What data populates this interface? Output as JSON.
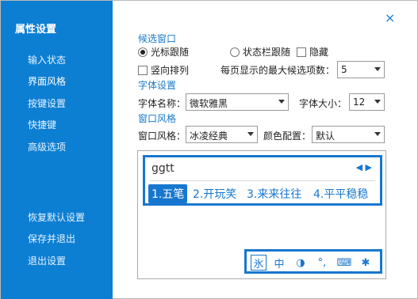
{
  "sidebar": {
    "title": "属性设置",
    "items": [
      {
        "label": "输入状态"
      },
      {
        "label": "界面风格"
      },
      {
        "label": "按键设置"
      },
      {
        "label": "快捷键"
      },
      {
        "label": "高级选项"
      }
    ],
    "bottom_items": [
      {
        "label": "恢复默认设置"
      },
      {
        "label": "保存并退出"
      },
      {
        "label": "退出设置"
      }
    ]
  },
  "close_icon": "×",
  "candidate_window": {
    "title": "候选窗口",
    "follow_cursor": "光标跟随",
    "follow_statusbar": "状态栏跟随",
    "hide": "隐藏",
    "vertical": "竖向排列",
    "max_count_label": "每页显示的最大候选项数：",
    "max_count_value": "5"
  },
  "font_settings": {
    "title": "字体设置",
    "name_label": "字体名称：",
    "name_value": "微软雅黑",
    "size_label": "字体大小：",
    "size_value": "12"
  },
  "window_style": {
    "title": "窗口风格",
    "style_label": "窗口风格：",
    "style_value": "冰凌经典",
    "color_label": "颜色配置：",
    "color_value": "默认"
  },
  "preview": {
    "input": "ggtt",
    "nav": "◀ ▶",
    "candidates": [
      "1.五笔",
      "2.开玩笑",
      "3.来来往往",
      "4.平平稳稳"
    ],
    "tools": [
      "氷",
      "中",
      "◑",
      "°,",
      "⌨",
      "✱"
    ]
  },
  "colors": {
    "sidebar_bg": "#0d7fd3",
    "accent": "#1777cf"
  }
}
